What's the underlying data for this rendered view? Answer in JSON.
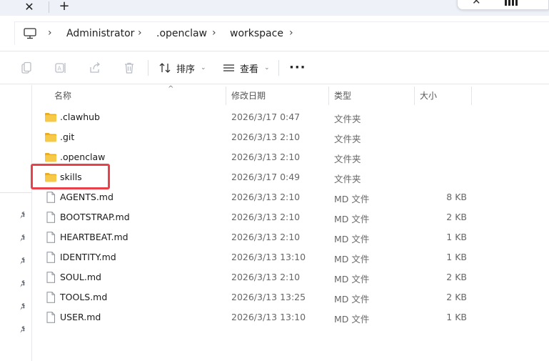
{
  "tabbar": {
    "close_glyph": "✕",
    "add_glyph": "+"
  },
  "window": {
    "close_glyph": "✕"
  },
  "breadcrumb": {
    "items": [
      "Administrator",
      ".openclaw",
      "workspace"
    ],
    "separator": "›"
  },
  "toolbar": {
    "sort_label": "排序",
    "view_label": "查看",
    "more_label": "···",
    "caret": "⌄",
    "icons": [
      "copy-icon",
      "rename-icon",
      "share-icon",
      "delete-icon",
      "sort-icon",
      "view-icon"
    ]
  },
  "columns": {
    "name": "名称",
    "modified": "修改日期",
    "type": "类型",
    "size": "大小",
    "sort_indicator": "^"
  },
  "files": [
    {
      "name": ".clawhub",
      "date": "2026/3/17 0:47",
      "type": "文件夹",
      "size": "",
      "kind": "folder"
    },
    {
      "name": ".git",
      "date": "2026/3/13 2:10",
      "type": "文件夹",
      "size": "",
      "kind": "folder"
    },
    {
      "name": ".openclaw",
      "date": "2026/3/13 2:10",
      "type": "文件夹",
      "size": "",
      "kind": "folder"
    },
    {
      "name": "skills",
      "date": "2026/3/17 0:49",
      "type": "文件夹",
      "size": "",
      "kind": "folder"
    },
    {
      "name": "AGENTS.md",
      "date": "2026/3/13 2:10",
      "type": "MD 文件",
      "size": "8 KB",
      "kind": "file"
    },
    {
      "name": "BOOTSTRAP.md",
      "date": "2026/3/13 2:10",
      "type": "MD 文件",
      "size": "2 KB",
      "kind": "file"
    },
    {
      "name": "HEARTBEAT.md",
      "date": "2026/3/13 2:10",
      "type": "MD 文件",
      "size": "1 KB",
      "kind": "file"
    },
    {
      "name": "IDENTITY.md",
      "date": "2026/3/13 13:10",
      "type": "MD 文件",
      "size": "1 KB",
      "kind": "file"
    },
    {
      "name": "SOUL.md",
      "date": "2026/3/13 2:10",
      "type": "MD 文件",
      "size": "2 KB",
      "kind": "file"
    },
    {
      "name": "TOOLS.md",
      "date": "2026/3/13 13:25",
      "type": "MD 文件",
      "size": "2 KB",
      "kind": "file"
    },
    {
      "name": "USER.md",
      "date": "2026/3/13 13:10",
      "type": "MD 文件",
      "size": "1 KB",
      "kind": "file"
    }
  ],
  "colors": {
    "folder": "#f7c948",
    "folder_dark": "#e9ae22",
    "highlight": "#e8414a"
  }
}
